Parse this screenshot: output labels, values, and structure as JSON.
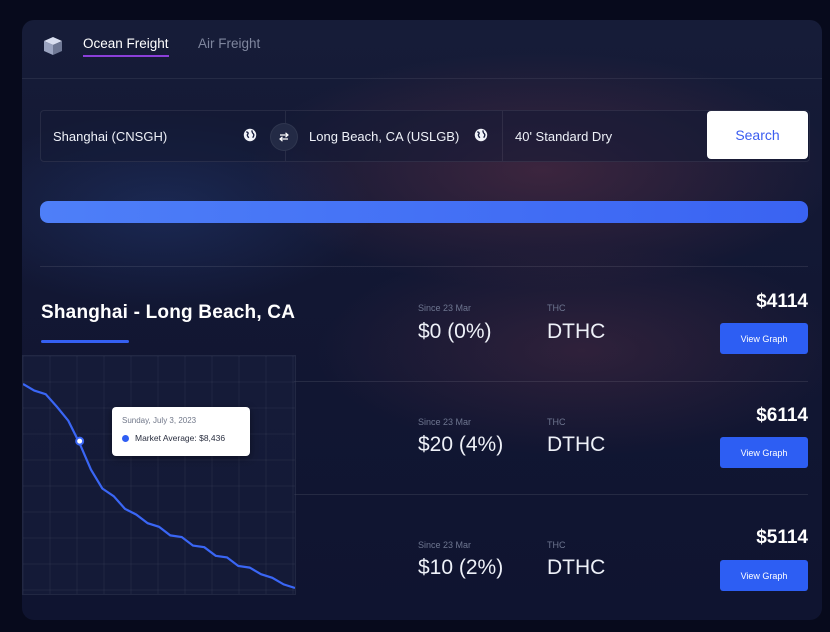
{
  "nav": {
    "tabs": [
      {
        "label": "Ocean Freight",
        "active": true
      },
      {
        "label": "Air Freight",
        "active": false
      }
    ]
  },
  "search": {
    "origin": "Shanghai (CNSGH)",
    "destination": "Long Beach, CA (USLGB)",
    "container": "40' Standard Dry",
    "button_label": "Search"
  },
  "progress": {
    "percent": 100
  },
  "route": {
    "title": "Shanghai - Long Beach, CA",
    "tooltip": {
      "date": "Sunday, July 3, 2023",
      "label": "Market Average: $8,436"
    },
    "chart_series": [
      100,
      98,
      95,
      90,
      82,
      72,
      58,
      50,
      45,
      40,
      36,
      33,
      30,
      27,
      25,
      22,
      20,
      17,
      15,
      12,
      10,
      8,
      5,
      3,
      0
    ]
  },
  "rates": [
    {
      "since_label": "Since 23 Mar",
      "change": "$0 (0%)",
      "thc_label": "THC",
      "thc_value": "DTHC",
      "price": "$4114",
      "button_label": "View Graph"
    },
    {
      "since_label": "Since 23 Mar",
      "change": "$20 (4%)",
      "thc_label": "THC",
      "thc_value": "DTHC",
      "price": "$6114",
      "button_label": "View Graph"
    },
    {
      "since_label": "Since 23 Mar",
      "change": "$10 (2%)",
      "thc_label": "THC",
      "thc_value": "DTHC",
      "price": "$5114",
      "button_label": "View Graph"
    }
  ],
  "colors": {
    "accent": "#2d5ef3",
    "active_tab_underline": "#8b3fd9",
    "background": "#121733"
  },
  "icons": {
    "logo": "cube-logo-icon",
    "globe": "globe-icon",
    "swap": "swap-arrows-icon",
    "marker": "dot-icon"
  }
}
